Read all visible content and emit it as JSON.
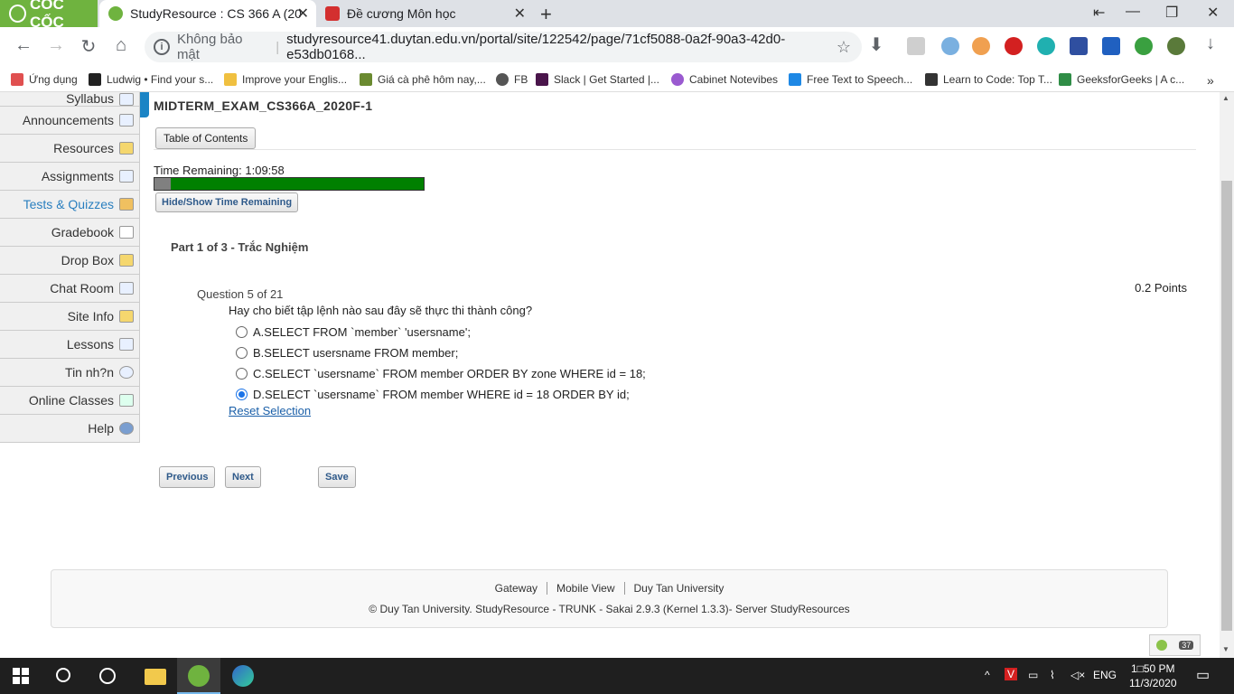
{
  "browser": {
    "brand": "CỐC CỐC",
    "tabs": [
      {
        "title": "StudyResource : CS 366 A (20",
        "active": true
      },
      {
        "title": "Đề cương Môn học",
        "active": false
      }
    ],
    "security_label": "Không bảo mật",
    "url": "studyresource41.duytan.edu.vn/portal/site/122542/page/71cf5088-0a2f-90a3-42d0-e53db0168...",
    "bookmarks": [
      "Ứng dụng",
      "Ludwig • Find your s...",
      "Improve your Englis...",
      "Giá cà phê hôm nay,...",
      "FB",
      "Slack | Get Started |...",
      "Cabinet Notevibes",
      "Free Text to Speech...",
      "Learn to Code: Top T...",
      "GeeksforGeeks | A c..."
    ],
    "bookmarks_overflow": "»"
  },
  "sidebar": {
    "items": [
      {
        "label": "Syllabus"
      },
      {
        "label": "Announcements"
      },
      {
        "label": "Resources"
      },
      {
        "label": "Assignments"
      },
      {
        "label": "Tests & Quizzes",
        "active": true
      },
      {
        "label": "Gradebook"
      },
      {
        "label": "Drop Box"
      },
      {
        "label": "Chat Room"
      },
      {
        "label": "Site Info"
      },
      {
        "label": "Lessons"
      },
      {
        "label": "Tin nh?n"
      },
      {
        "label": "Online Classes"
      },
      {
        "label": "Help"
      }
    ]
  },
  "exam": {
    "title": "MIDTERM_EXAM_CS366A_2020F-1",
    "toc_label": "Table of Contents",
    "time_remaining": "Time Remaining: 1:09:58",
    "time_used_fraction": 0.06,
    "toggle_time_label": "Hide/Show Time Remaining",
    "part": "Part 1 of 3 - Trắc Nghiệm",
    "question_number": "Question 5 of 21",
    "points": "0.2 Points",
    "question_text": "Hay cho biết tập lệnh nào sau đây sẽ thực thi thành công?",
    "options": [
      {
        "text": "A.SELECT FROM `member` 'usersname';",
        "selected": false
      },
      {
        "text": "B.SELECT usersname FROM member;",
        "selected": false
      },
      {
        "text": "C.SELECT `usersname` FROM member ORDER BY zone WHERE id = 18;",
        "selected": false
      },
      {
        "text": "D.SELECT `usersname` FROM member WHERE id = 18 ORDER BY id;",
        "selected": true
      }
    ],
    "reset_label": "Reset Selection",
    "previous_label": "Previous",
    "next_label": "Next",
    "save_label": "Save"
  },
  "footer": {
    "links": [
      "Gateway",
      "Mobile View",
      "Duy Tan University"
    ],
    "copyright": "© Duy Tan University. StudyResource - TRUNK - Sakai 2.9.3 (Kernel 1.3.3)- Server StudyResources",
    "online_users": "37"
  },
  "taskbar": {
    "language": "ENG",
    "time": "1□50 PM",
    "date": "11/3/2020"
  },
  "colors": {
    "timer_remaining": "#008000",
    "timer_used": "#808080",
    "accent": "#1a84c5",
    "brand": "#6fb33f"
  }
}
